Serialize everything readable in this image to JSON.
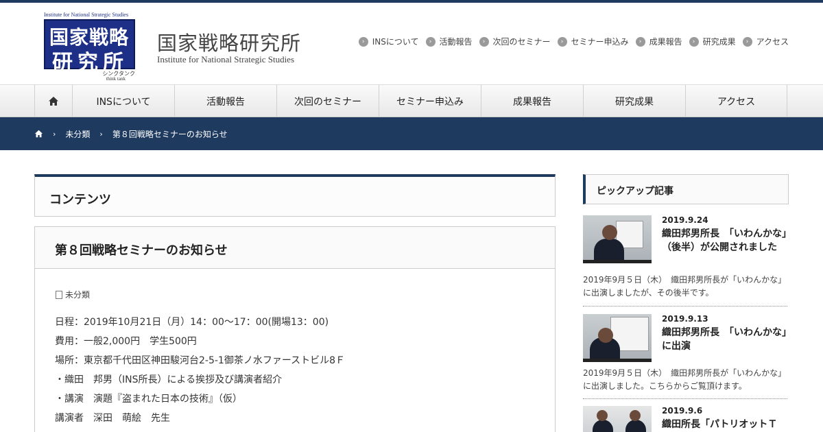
{
  "header": {
    "logo": {
      "top_text": "Institute for National Strategic Studies",
      "line1": "国家戦略",
      "line2": "研究所",
      "sub1": "シンクタンク",
      "sub2": "think tank"
    },
    "site_title": "国家戦略研究所",
    "site_subtitle": "Institute for National Strategic Studies",
    "top_nav": [
      "INSについて",
      "活動報告",
      "次回のセミナー",
      "セミナー申込み",
      "成果報告",
      "研究成果",
      "アクセス"
    ]
  },
  "global_nav": {
    "home_icon": "home-icon",
    "items": [
      "INSについて",
      "活動報告",
      "次回のセミナー",
      "セミナー申込み",
      "成果報告",
      "研究成果",
      "アクセス"
    ]
  },
  "breadcrumb": {
    "home_icon": "home-icon",
    "items": [
      "未分類",
      "第８回戦略セミナーのお知らせ"
    ]
  },
  "contents_box": {
    "title": "コンテンツ"
  },
  "article": {
    "title": "第８回戦略セミナーのお知らせ",
    "category": "未分類",
    "lines": [
      "日程：2019年10月21日（月）14：00～17：00(開場13：00)",
      "費用：一般2,000円　学生500円",
      "場所：東京都千代田区神田駿河台2-5-1御茶ノ水ファーストビル8Ｆ",
      "・織田　邦男（INS所長）による挨拶及び講演者紹介",
      "・講演　演題『盗まれた日本の技術』（仮）",
      "講演者　深田　萌絵　先生"
    ]
  },
  "sidebar": {
    "pickup_title": "ピックアップ記事",
    "posts": [
      {
        "date": "2019.9.24",
        "title": "織田邦男所長　「いわんかな」（後半）が公開されました",
        "excerpt": "2019年9月５日（木）　織田邦男所長が「いわんかな」に出演しましたが、その後半です。"
      },
      {
        "date": "2019.9.13",
        "title": "織田邦男所長　「いわんかな」に出演",
        "excerpt": "2019年9月５日（木）　織田邦男所長が「いわんかな」に出演しました。こちらからご覧頂けます。"
      },
      {
        "date": "2019.9.6",
        "title": "織田所長「パトリオットＴ",
        "excerpt": ""
      }
    ]
  },
  "colors": {
    "navy": "#1e3a5f",
    "logo_blue": "#1d2f86"
  }
}
